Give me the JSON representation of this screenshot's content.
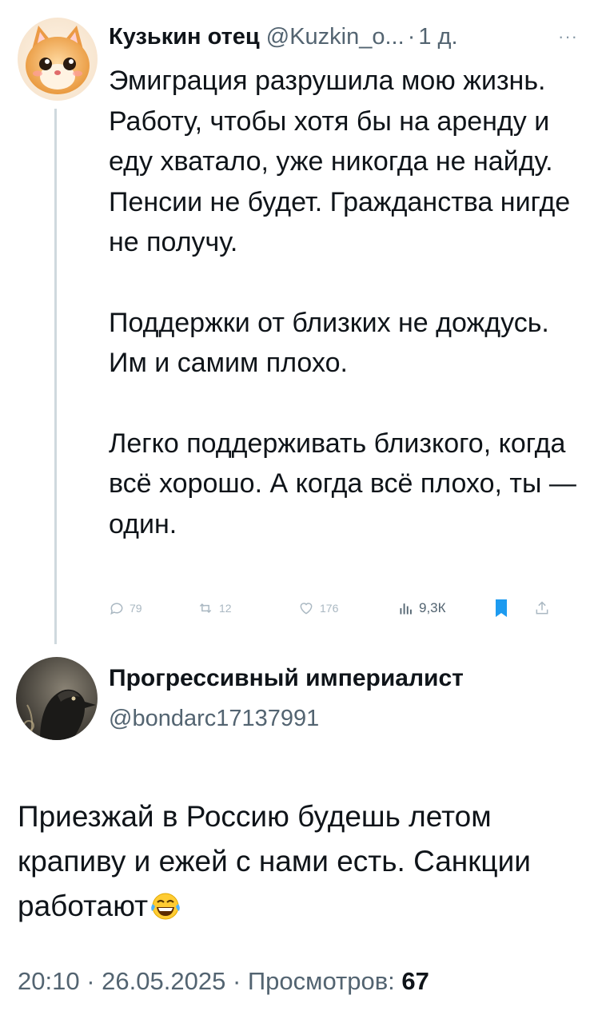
{
  "tweet1": {
    "author_name": "Кузькин отец",
    "author_handle": "@Kuzkin_o...",
    "separator": "·",
    "time_ago": "1 д.",
    "more": "···",
    "paragraphs": [
      "Эмиграция разрушила мою жизнь. Работу, чтобы хотя бы на аренду и еду хватало, уже никогда не найду. Пенсии не будет. Гражданства нигде не получу.",
      "Поддержки от близких не дождусь. Им и самим плохо.",
      "Легко поддерживать близкого, когда всё хорошо. А когда всё плохо, ты — один."
    ],
    "actions": {
      "replies": "79",
      "reposts": "12",
      "likes": "176",
      "views": "9,3К"
    }
  },
  "tweet2": {
    "author_name": "Прогрессивный империалист",
    "author_handle": "@bondarc17137991",
    "text": "Приезжай в Россию будешь летом крапиву и ежей с нами есть. Санкции работают",
    "time": "20:10",
    "sep1": "·",
    "date": "26.05.2025",
    "sep2": "·",
    "views_label": "Просмотров:",
    "views_count": "67"
  },
  "colors": {
    "text": "#0f1419",
    "secondary": "#536471",
    "bookmark": "#1d9bf0",
    "thread_line": "#cfd9de"
  },
  "icons": [
    "kitten-avatar",
    "raven-avatar",
    "reply-icon",
    "repost-icon",
    "like-icon",
    "views-icon",
    "bookmark-icon",
    "share-icon",
    "laughing-emoji"
  ]
}
